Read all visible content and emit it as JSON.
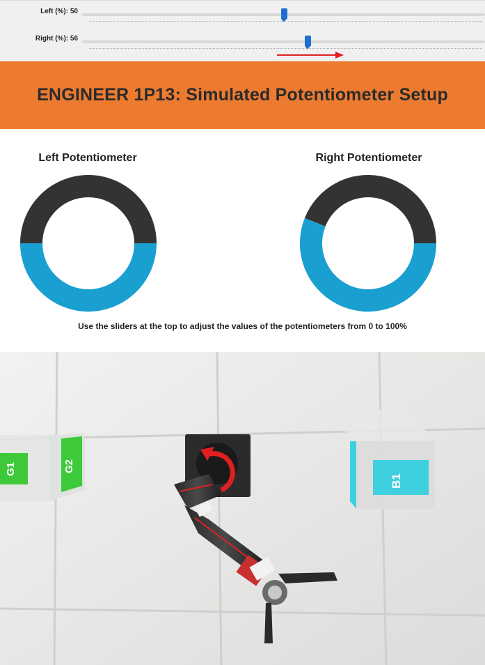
{
  "sliders": {
    "left": {
      "label": "Left (%): 50",
      "value": 50
    },
    "right": {
      "label": "Right (%): 56",
      "value": 56
    }
  },
  "banner": {
    "title": "ENGINEER 1P13: Simulated Potentiometer Setup"
  },
  "gauges": {
    "left": {
      "title": "Left Potentiometer",
      "value": 50
    },
    "right": {
      "title": "Right Potentiometer",
      "value": 56
    },
    "fill_color": "#1a9fd1",
    "empty_color": "#333333"
  },
  "instructions": "Use the sliders at the top to adjust the values of the potentiometers from 0 to 100%",
  "scene": {
    "containers": {
      "g1": "G1",
      "g2": "G2",
      "b1": "B1"
    },
    "colors": {
      "green": "#3ec93a",
      "blue": "#3fd0e0",
      "arrow_red": "#e02020"
    }
  }
}
